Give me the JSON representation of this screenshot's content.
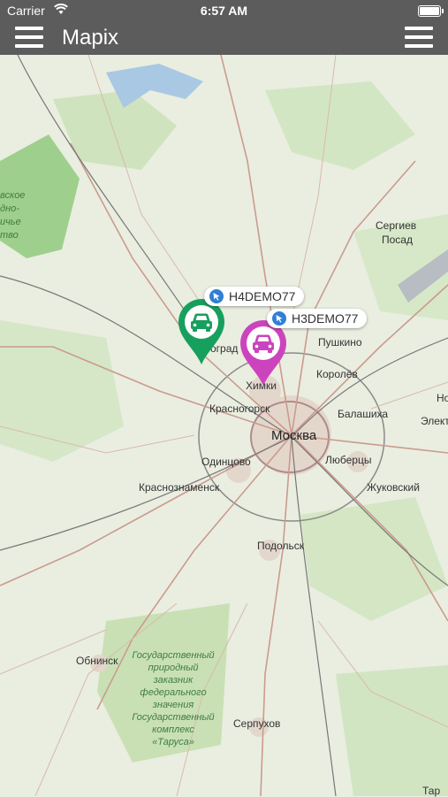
{
  "status_bar": {
    "carrier": "Carrier",
    "time": "6:57 AM"
  },
  "nav": {
    "title": "Mapix",
    "left_icon": "menu-icon",
    "right_icon": "menu-icon"
  },
  "map": {
    "cities": {
      "moscow": "Москва",
      "sergiev_posad_1": "Сергиев",
      "sergiev_posad_2": "Посад",
      "pushkino": "Пушкино",
      "korolev": "Королёв",
      "khimki": "Химки",
      "zelenograd_partial": "оград",
      "krasnogorsk": "Красногорск",
      "balashikha": "Балашиха",
      "elektrostal_partial": "Элект",
      "noginsk_partial": "Но",
      "odintsovo": "Одинцово",
      "lyubertsy": "Люберцы",
      "krasnoznamensk": "Краснознаменск",
      "zhukovsky": "Жуковский",
      "podolsk": "Подольск",
      "obninsk": "Обнинск",
      "serpukhov": "Серпухов",
      "tarusa_partial": "Тар"
    },
    "reserve_text": [
      "Государственный",
      "природный",
      "заказник",
      "федерального",
      "значения",
      "Государственный",
      "комплекс",
      "«Таруса»"
    ],
    "west_text": [
      "вское",
      "дно-",
      "ичье",
      "тво"
    ]
  },
  "vehicles": [
    {
      "label": "H4DEMO77",
      "color": "#17a05d",
      "icon": "car-icon"
    },
    {
      "label": "H3DEMO77",
      "color": "#cc44bd",
      "icon": "car-icon"
    }
  ]
}
